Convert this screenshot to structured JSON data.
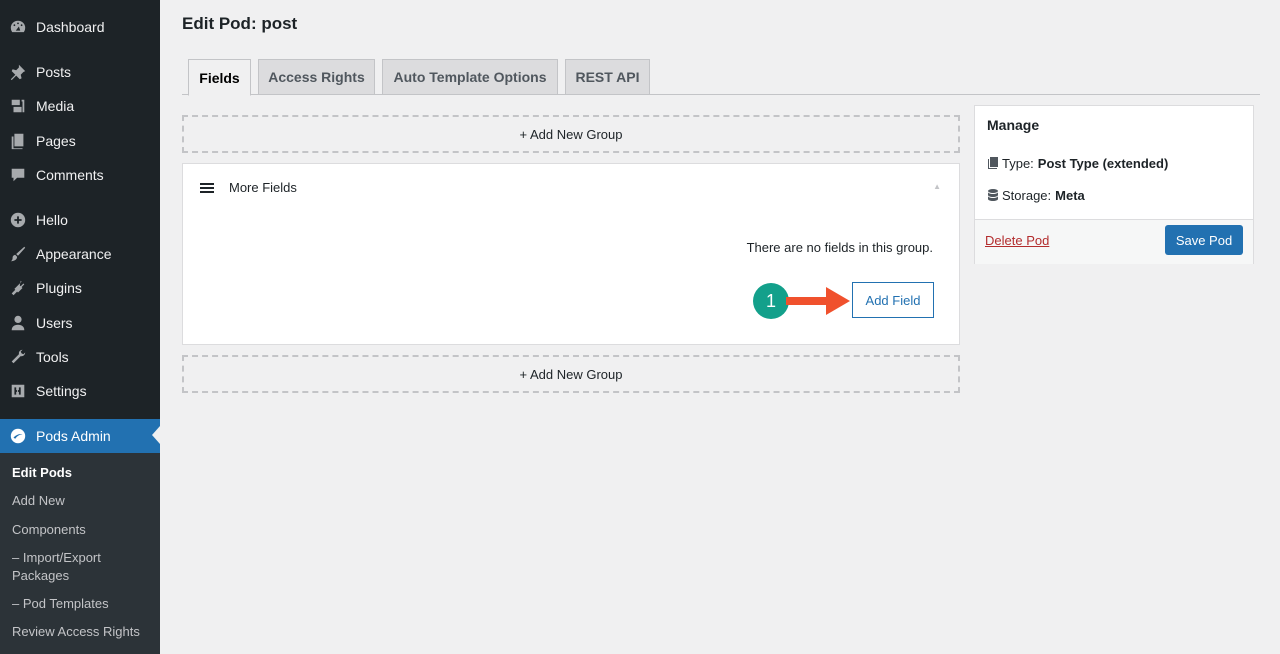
{
  "sidebar": {
    "items": [
      {
        "label": "Dashboard",
        "icon": "dashboard-icon"
      },
      {
        "label": "Posts",
        "icon": "pin-icon"
      },
      {
        "label": "Media",
        "icon": "media-icon"
      },
      {
        "label": "Pages",
        "icon": "pages-icon"
      },
      {
        "label": "Comments",
        "icon": "comment-icon"
      },
      {
        "label": "Hello",
        "icon": "plus-circle-icon"
      },
      {
        "label": "Appearance",
        "icon": "brush-icon"
      },
      {
        "label": "Plugins",
        "icon": "plug-icon"
      },
      {
        "label": "Users",
        "icon": "user-icon"
      },
      {
        "label": "Tools",
        "icon": "wrench-icon"
      },
      {
        "label": "Settings",
        "icon": "settings-icon"
      },
      {
        "label": "Pods Admin",
        "icon": "pods-icon"
      }
    ],
    "submenu": [
      {
        "label": "Edit Pods"
      },
      {
        "label": "Add New"
      },
      {
        "label": "Components"
      },
      {
        "label": "– Import/Export Packages"
      },
      {
        "label": "– Pod Templates"
      },
      {
        "label": "Review Access Rights"
      }
    ]
  },
  "page": {
    "title": "Edit Pod:  post"
  },
  "tabs": [
    {
      "label": "Fields"
    },
    {
      "label": "Access Rights"
    },
    {
      "label": "Auto Template Options"
    },
    {
      "label": "REST API"
    }
  ],
  "fields": {
    "add_group_label": "+ Add New Group",
    "group_name": "More Fields",
    "toggle_glyph": "▲",
    "empty_message": "There are no fields in this group.",
    "add_field_label": "Add Field",
    "step_number": "1"
  },
  "manage": {
    "title": "Manage",
    "type_label": "Type:",
    "type_value": "Post Type (extended)",
    "storage_label": "Storage:",
    "storage_value": "Meta",
    "delete_label": "Delete Pod",
    "save_label": "Save Pod"
  },
  "colors": {
    "sidebar_bg": "#1d2327",
    "accent": "#2271b1",
    "step_badge": "#13a08b",
    "arrow": "#f0512d",
    "delete": "#b32d2e"
  }
}
